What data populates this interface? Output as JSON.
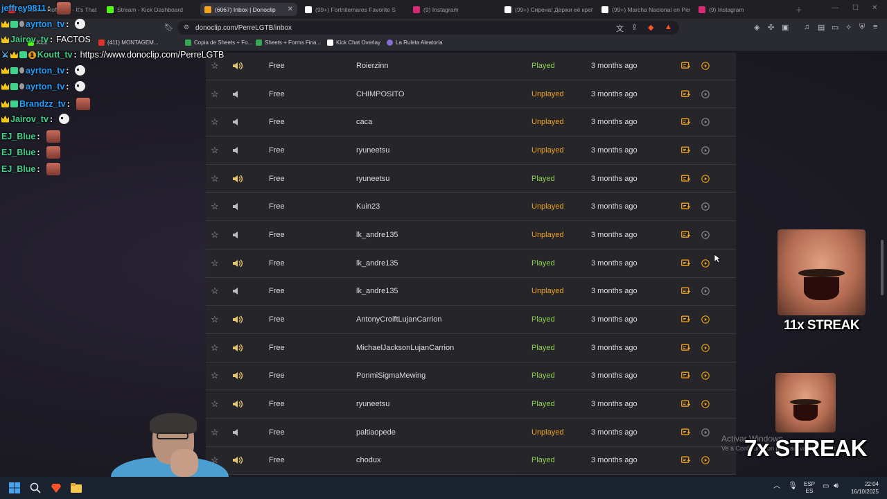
{
  "browser": {
    "tabs": [
      {
        "label": "(8) Marlon Hoffstadt - It's That",
        "favicon_color": "#e0312b"
      },
      {
        "label": "Stream - Kick Dashboard",
        "favicon_color": "#53fc18"
      },
      {
        "label": "(6067) Inbox | Donoclip",
        "favicon_color": "#f0a31a",
        "active": true
      },
      {
        "label": "(99+) Fortnitemares Favorite S",
        "favicon_color": "#ffffff"
      },
      {
        "label": "(9) Instagram",
        "favicon_color": "#d62976"
      },
      {
        "label": "(99+) Сирена! Держи её крепк",
        "favicon_color": "#ffffff"
      },
      {
        "label": "(99+) Marcha Nacional en Perú",
        "favicon_color": "#ffffff"
      },
      {
        "label": "(9) Instagram",
        "favicon_color": "#d62976"
      }
    ],
    "url": "donoclip.com/PerreLGTB/inbox",
    "bookmarks": [
      {
        "label": "Kick",
        "color": "#53fc18"
      },
      {
        "label": "(411) MONTAGEM...",
        "color": "#e0312b"
      },
      {
        "label": "Copia de Sheets + Fo...",
        "color": "#34a853"
      },
      {
        "label": "Sheets + Forms Fina...",
        "color": "#34a853"
      },
      {
        "label": "Kick Chat Overlay",
        "color": "#ffffff"
      },
      {
        "label": "La Ruleta Aleatoria",
        "color": "#8a6bd6"
      }
    ]
  },
  "inbox": {
    "rows": [
      {
        "tier": "Free",
        "user": "Roierzinn",
        "status": "Played",
        "time": "3 months ago"
      },
      {
        "tier": "Free",
        "user": "CHIMPOSITO",
        "status": "Unplayed",
        "time": "3 months ago"
      },
      {
        "tier": "Free",
        "user": "caca",
        "status": "Unplayed",
        "time": "3 months ago"
      },
      {
        "tier": "Free",
        "user": "ryuneetsu",
        "status": "Unplayed",
        "time": "3 months ago"
      },
      {
        "tier": "Free",
        "user": "ryuneetsu",
        "status": "Played",
        "time": "3 months ago"
      },
      {
        "tier": "Free",
        "user": "Kuin23",
        "status": "Unplayed",
        "time": "3 months ago"
      },
      {
        "tier": "Free",
        "user": "lk_andre135",
        "status": "Unplayed",
        "time": "3 months ago"
      },
      {
        "tier": "Free",
        "user": "lk_andre135",
        "status": "Played",
        "time": "3 months ago"
      },
      {
        "tier": "Free",
        "user": "lk_andre135",
        "status": "Unplayed",
        "time": "3 months ago"
      },
      {
        "tier": "Free",
        "user": "AntonyCroiftLujanCarrion",
        "status": "Played",
        "time": "3 months ago"
      },
      {
        "tier": "Free",
        "user": "MichaelJacksonLujanCarrion",
        "status": "Played",
        "time": "3 months ago"
      },
      {
        "tier": "Free",
        "user": "PonmiSigmaMewing",
        "status": "Played",
        "time": "3 months ago"
      },
      {
        "tier": "Free",
        "user": "ryuneetsu",
        "status": "Played",
        "time": "3 months ago"
      },
      {
        "tier": "Free",
        "user": "paltiaopede",
        "status": "Unplayed",
        "time": "3 months ago"
      },
      {
        "tier": "Free",
        "user": "chodux",
        "status": "Played",
        "time": "3 months ago"
      }
    ],
    "colors": {
      "played": "#8fd14f",
      "unplayed": "#f0a31a"
    }
  },
  "chat": [
    {
      "user": "jeffrey9811",
      "color": "#1ea0ff",
      "message": ""
    },
    {
      "user": "ayrton_tv",
      "color": "#1ea0ff",
      "message": ""
    },
    {
      "user": "Jairov_tv",
      "color": "#3fd28a",
      "message": "FACTOS"
    },
    {
      "user": "Koutt_tv",
      "color": "#3fd28a",
      "message": "https://www.donoclip.com/PerreLGTB"
    },
    {
      "user": "ayrton_tv",
      "color": "#1ea0ff",
      "message": ""
    },
    {
      "user": "ayrton_tv",
      "color": "#1ea0ff",
      "message": ""
    },
    {
      "user": "Brandzz_tv",
      "color": "#1ea0ff",
      "message": ""
    },
    {
      "user": "Jairov_tv",
      "color": "#3fd28a",
      "message": ""
    },
    {
      "user": "EJ_Blue",
      "color": "#3fd28a",
      "message": ""
    },
    {
      "user": "EJ_Blue",
      "color": "#3fd28a",
      "message": ""
    },
    {
      "user": "EJ_Blue",
      "color": "#3fd28a",
      "message": ""
    }
  ],
  "overlay": {
    "streak_top": "11x STREAK",
    "streak_bottom": "7x STREAK",
    "watermark_title": "Activar Windows",
    "watermark_sub": "Ve a Configuración para activar Windows."
  },
  "taskbar": {
    "lang_top": "ESP",
    "lang_bottom": "ES",
    "time": "22:04",
    "date": "16/10/2025"
  }
}
